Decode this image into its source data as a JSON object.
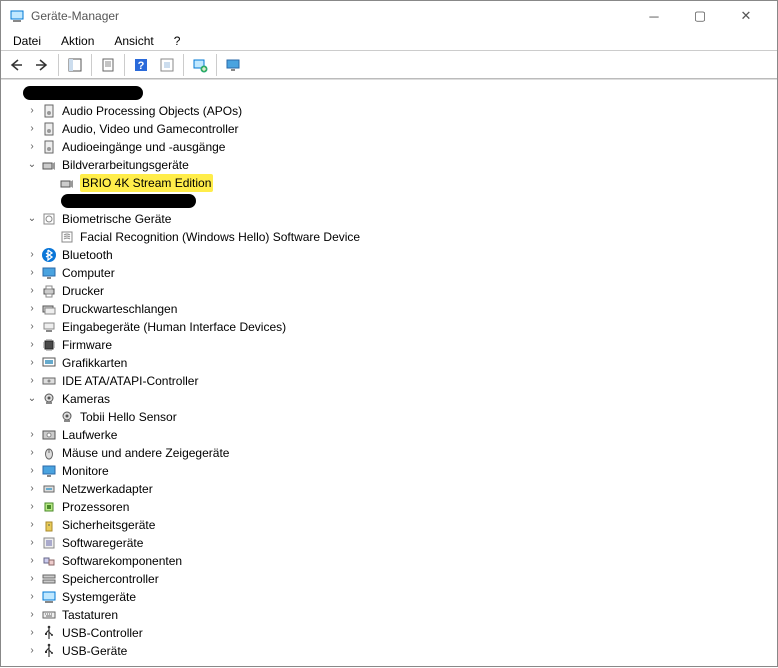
{
  "window": {
    "title": "Geräte-Manager"
  },
  "menu": {
    "items": [
      {
        "label": "Datei"
      },
      {
        "label": "Aktion"
      },
      {
        "label": "Ansicht"
      },
      {
        "label": "?"
      }
    ]
  },
  "toolbar": {
    "items": [
      {
        "name": "back-icon"
      },
      {
        "name": "forward-icon"
      },
      {
        "sep": true
      },
      {
        "name": "showhide-tree-icon"
      },
      {
        "sep": true
      },
      {
        "name": "properties-icon"
      },
      {
        "sep": true
      },
      {
        "name": "help-icon"
      },
      {
        "name": "action-icon"
      },
      {
        "sep": true
      },
      {
        "name": "scan-hardware-icon"
      },
      {
        "sep": true
      },
      {
        "name": "monitor-icon"
      }
    ]
  },
  "tree": [
    {
      "level": 0,
      "expanded": true,
      "redacted": true,
      "icon": "computer-icon",
      "label": ""
    },
    {
      "level": 1,
      "collapsed": true,
      "icon": "speaker-icon",
      "label": "Audio Processing Objects (APOs)"
    },
    {
      "level": 1,
      "collapsed": true,
      "icon": "speaker-icon",
      "label": "Audio, Video und Gamecontroller"
    },
    {
      "level": 1,
      "collapsed": true,
      "icon": "speaker-icon",
      "label": "Audioeingänge und -ausgänge"
    },
    {
      "level": 1,
      "expanded": true,
      "icon": "camera-icon",
      "label": "Bildverarbeitungsgeräte"
    },
    {
      "level": 2,
      "leaf": true,
      "icon": "camera-icon",
      "highlight": true,
      "label": "BRIO 4K Stream Edition"
    },
    {
      "level": 2,
      "leaf": true,
      "redactedBelow": true,
      "label": ""
    },
    {
      "level": 1,
      "expanded": true,
      "icon": "biometric-icon",
      "label": "Biometrische Geräte"
    },
    {
      "level": 2,
      "leaf": true,
      "icon": "fingerprint-icon",
      "label": "Facial Recognition (Windows Hello) Software Device"
    },
    {
      "level": 1,
      "collapsed": true,
      "icon": "bluetooth-icon",
      "label": "Bluetooth"
    },
    {
      "level": 1,
      "collapsed": true,
      "icon": "monitor-icon-blue",
      "label": "Computer"
    },
    {
      "level": 1,
      "collapsed": true,
      "icon": "printer-icon",
      "label": "Drucker"
    },
    {
      "level": 1,
      "collapsed": true,
      "icon": "queue-icon",
      "label": "Druckwarteschlangen"
    },
    {
      "level": 1,
      "collapsed": true,
      "icon": "hid-icon",
      "label": "Eingabegeräte (Human Interface Devices)"
    },
    {
      "level": 1,
      "collapsed": true,
      "icon": "chip-icon",
      "label": "Firmware"
    },
    {
      "level": 1,
      "collapsed": true,
      "icon": "display-adapter-icon",
      "label": "Grafikkarten"
    },
    {
      "level": 1,
      "collapsed": true,
      "icon": "ide-icon",
      "label": "IDE ATA/ATAPI-Controller"
    },
    {
      "level": 1,
      "expanded": true,
      "icon": "webcam-icon",
      "label": "Kameras"
    },
    {
      "level": 2,
      "leaf": true,
      "icon": "webcam-icon",
      "label": "Tobii Hello Sensor"
    },
    {
      "level": 1,
      "collapsed": true,
      "icon": "disk-icon",
      "label": "Laufwerke"
    },
    {
      "level": 1,
      "collapsed": true,
      "icon": "mouse-icon",
      "label": "Mäuse und andere Zeigegeräte"
    },
    {
      "level": 1,
      "collapsed": true,
      "icon": "monitor-icon-blue",
      "label": "Monitore"
    },
    {
      "level": 1,
      "collapsed": true,
      "icon": "network-icon",
      "label": "Netzwerkadapter"
    },
    {
      "level": 1,
      "collapsed": true,
      "icon": "cpu-icon",
      "label": "Prozessoren"
    },
    {
      "level": 1,
      "collapsed": true,
      "icon": "security-icon",
      "label": "Sicherheitsgeräte"
    },
    {
      "level": 1,
      "collapsed": true,
      "icon": "software-icon",
      "label": "Softwaregeräte"
    },
    {
      "level": 1,
      "collapsed": true,
      "icon": "components-icon",
      "label": "Softwarekomponenten"
    },
    {
      "level": 1,
      "collapsed": true,
      "icon": "storage-controller-icon",
      "label": "Speichercontroller"
    },
    {
      "level": 1,
      "collapsed": true,
      "icon": "system-icon",
      "label": "Systemgeräte"
    },
    {
      "level": 1,
      "collapsed": true,
      "icon": "keyboard-icon",
      "label": "Tastaturen"
    },
    {
      "level": 1,
      "collapsed": true,
      "icon": "usb-icon",
      "label": "USB-Controller"
    },
    {
      "level": 1,
      "collapsed": true,
      "icon": "usb-icon",
      "label": "USB-Geräte"
    }
  ]
}
